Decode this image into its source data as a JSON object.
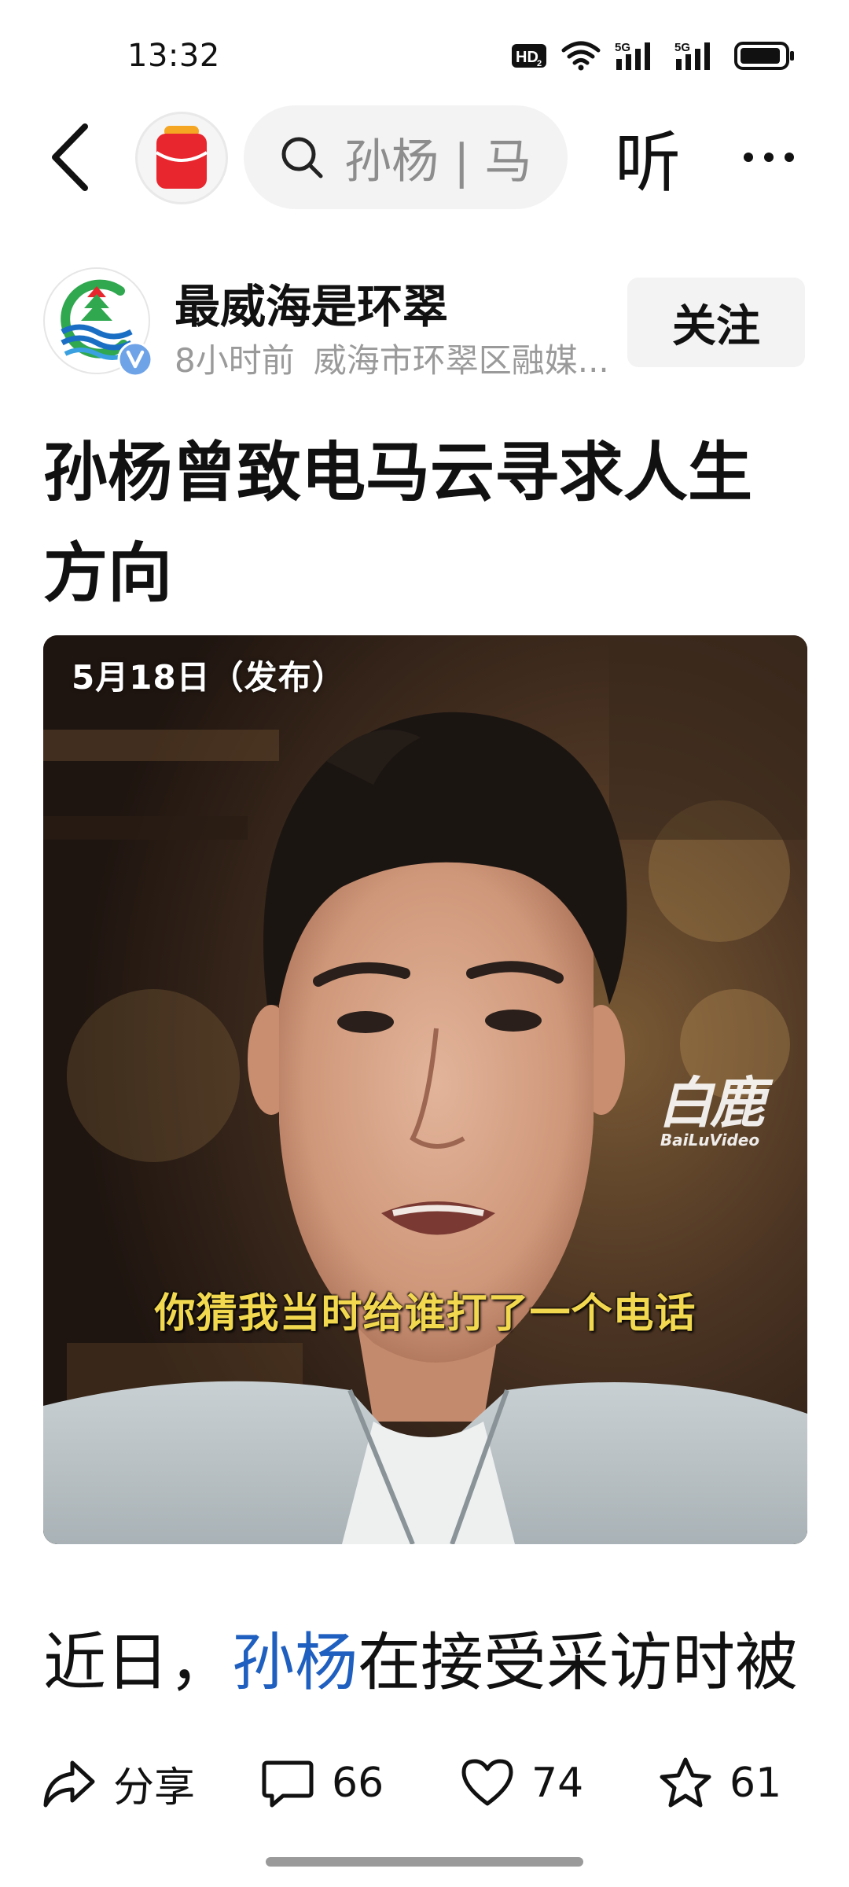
{
  "status_bar": {
    "time": "13:32",
    "icons": [
      "hd-voice-icon",
      "wifi-icon",
      "5g-signal-icon",
      "5g-signal-icon",
      "battery-icon"
    ]
  },
  "top_nav": {
    "search_text": "孙杨 | 马",
    "listen_label": "听"
  },
  "author": {
    "name": "最威海是环翠",
    "time_ago": "8小时前",
    "source": "威海市环翠区融媒...",
    "follow_label": "关注"
  },
  "article": {
    "title": "孙杨曾致电马云寻求人生方向",
    "image": {
      "date_caption": "5月18日（发布）",
      "subtitle_caption": "你猜我当时给谁打了一个电话",
      "watermark_cn": "白鹿",
      "watermark_en": "BaiLuVideo"
    },
    "body_prefix": "近日，",
    "body_keyword": "孙杨",
    "body_suffix": "在接受采访时被"
  },
  "actions": {
    "share_label": "分享",
    "comment_count": "66",
    "like_count": "74",
    "favorite_count": "61"
  }
}
